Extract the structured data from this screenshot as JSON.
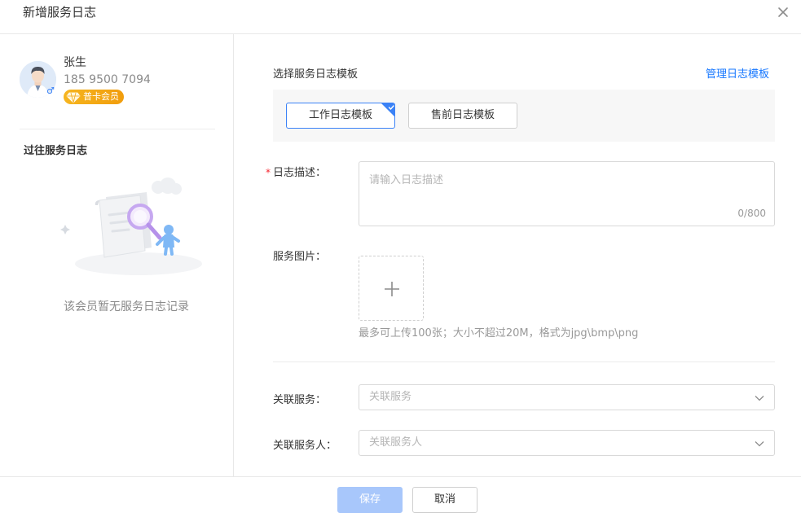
{
  "dialog": {
    "title": "新增服务日志",
    "close_icon": "close-icon"
  },
  "member": {
    "name": "张生",
    "phone": "185 9500 7094",
    "gender_symbol": "♂",
    "badge": "普卡会员",
    "badge_icon": "diamond-icon",
    "avatar_icon": "avatar-icon"
  },
  "history": {
    "title": "过往服务日志",
    "empty_text": "该会员暂无服务日志记录",
    "empty_icon": "empty-records-illustration"
  },
  "template": {
    "label": "选择服务日志模板",
    "manage_link": "管理日志模板",
    "options": [
      {
        "label": "工作日志模板",
        "selected": true
      },
      {
        "label": "售前日志模板",
        "selected": false
      }
    ]
  },
  "description": {
    "required_mark": "*",
    "label": "日志描述：",
    "placeholder": "请输入日志描述",
    "counter": "0/800"
  },
  "images": {
    "label": "服务图片：",
    "hint": "最多可上传100张；大小不超过20M，格式为jpg\\bmp\\png",
    "upload_icon": "plus-icon"
  },
  "related_service": {
    "label": "关联服务：",
    "placeholder": "关联服务"
  },
  "related_staff": {
    "label": "关联服务人：",
    "placeholder": "关联服务人"
  },
  "footer": {
    "save": "保存",
    "cancel": "取消"
  },
  "colors": {
    "accent": "#1677ff",
    "save_disabled": "#a8c7fb",
    "required": "#f5222d",
    "badge": "#f6b51f"
  }
}
